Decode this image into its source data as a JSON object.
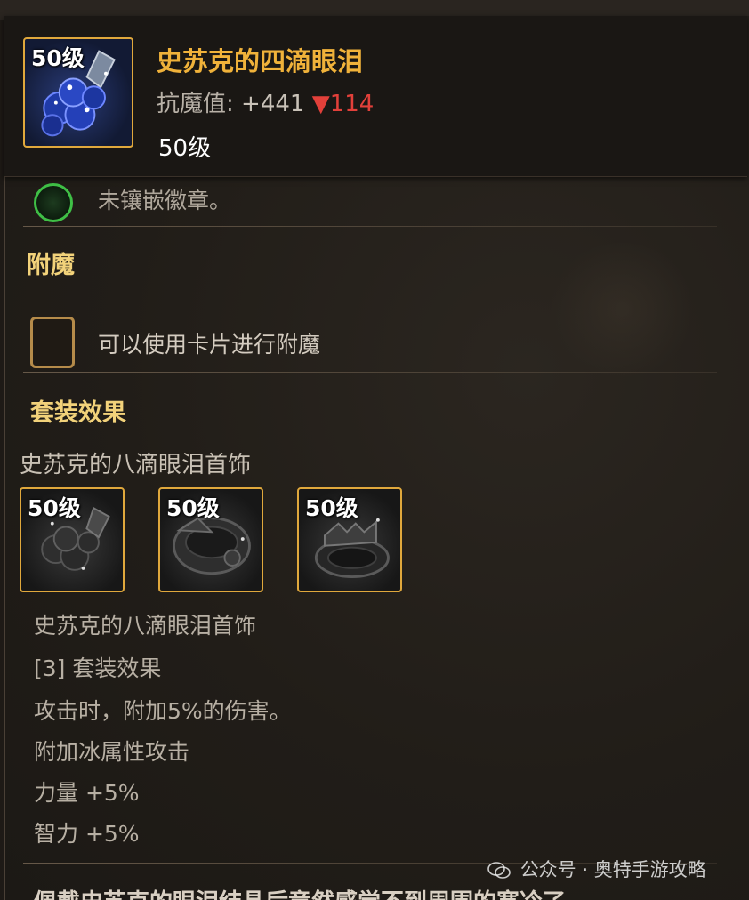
{
  "header": {
    "item_level_badge": "50级",
    "item_name": "史苏克的四滴眼泪",
    "stat_label": "抗魔值:",
    "stat_value": "+441",
    "stat_delta": "▼114",
    "level_text": "50级",
    "icon": "blue-jewel-earring-icon"
  },
  "cut_off_row": {
    "icon": "green-orb-icon",
    "text": "未镶嵌徽章。"
  },
  "enchant": {
    "title": "附魔",
    "slot_text": "可以使用卡片进行附魔"
  },
  "set_effect": {
    "title": "套装效果",
    "set_name": "史苏克的八滴眼泪首饰",
    "items": [
      {
        "level": "50级",
        "icon": "gray-earring-icon"
      },
      {
        "level": "50级",
        "icon": "gray-bracelet-icon"
      },
      {
        "level": "50级",
        "icon": "gray-ring-icon"
      }
    ],
    "lines": [
      "史苏克的八滴眼泪首饰",
      "[3] 套装效果",
      "攻击时，附加5%的伤害。",
      "附加冰属性攻击",
      "力量 +5%",
      "智力 +5%"
    ]
  },
  "footer_text": "佩戴史苏克的眼泪结晶后竟然感觉不到周围的寒冷了。",
  "watermark": {
    "icon": "wechat-icon",
    "text": "公众号 · 奥特手游攻略"
  },
  "colors": {
    "gold_name": "#f0b23a",
    "section_title": "#f2d27a",
    "delta_red": "#e2403a",
    "frame_gold": "#e0a83c"
  }
}
